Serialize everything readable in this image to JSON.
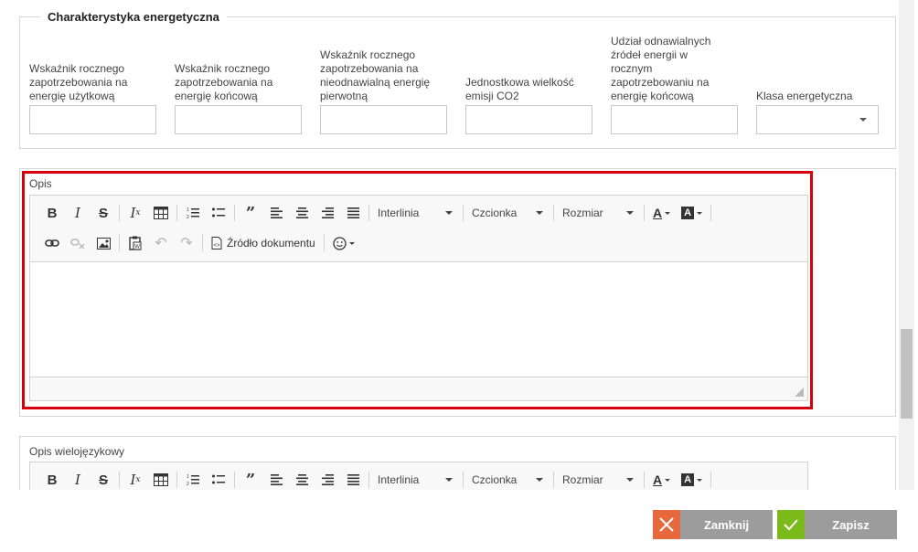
{
  "energy": {
    "legend": "Charakterystyka energetyczna",
    "fields": [
      {
        "label": "Wskaźnik rocznego zapotrzebowania na energię użytkową",
        "value": ""
      },
      {
        "label": "Wskaźnik rocznego zapotrzebowania na energię końcową",
        "value": ""
      },
      {
        "label": "Wskaźnik rocznego zapotrzebowania na nieodnawialną energię pierwotną",
        "value": ""
      },
      {
        "label": "Jednostkowa wielkość emisji CO2",
        "value": ""
      },
      {
        "label": "Udział odnawialnych źródeł energii w rocznym zapotrzebowaniu na energię końcową",
        "value": ""
      },
      {
        "label": "Klasa energetyczna",
        "value": ""
      }
    ]
  },
  "opis": {
    "label": "Opis",
    "toolbar": {
      "interlinia": "Interlinia",
      "czcionka": "Czcionka",
      "rozmiar": "Rozmiar",
      "source": "Źródło dokumentu"
    },
    "content": ""
  },
  "opis_multi": {
    "label": "Opis wielojęzykowy",
    "toolbar": {
      "interlinia": "Interlinia",
      "czcionka": "Czcionka",
      "rozmiar": "Rozmiar"
    }
  },
  "footer": {
    "close_label": "Zamknij",
    "save_label": "Zapisz",
    "close_color": "#e8683d",
    "save_color": "#7cba1b"
  },
  "colors": {
    "highlight": "#d9000d"
  }
}
